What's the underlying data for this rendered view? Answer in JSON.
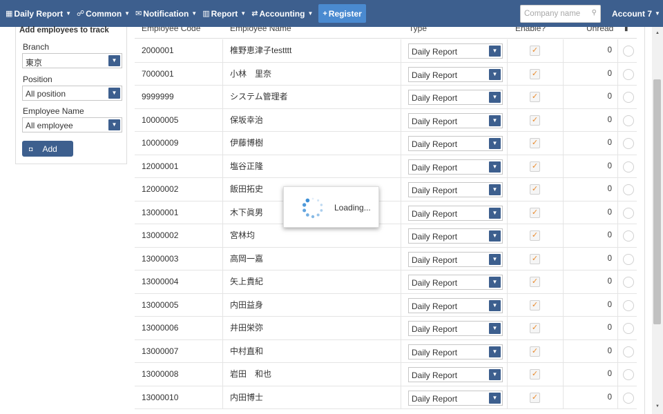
{
  "navbar": {
    "items": [
      {
        "label": "Daily Report",
        "icon": "calendar-icon",
        "glyph": "▦"
      },
      {
        "label": "Common",
        "icon": "users-icon",
        "glyph": "☍"
      },
      {
        "label": "Notification",
        "icon": "envelope-icon",
        "glyph": "✉"
      },
      {
        "label": "Report",
        "icon": "bar-chart-icon",
        "glyph": "▥"
      },
      {
        "label": "Accounting",
        "icon": "exchange-icon",
        "glyph": "⇄"
      }
    ],
    "register": {
      "label": "Register",
      "glyph": "+"
    },
    "search": {
      "placeholder": "Company name"
    },
    "account": {
      "label": "Account 7"
    },
    "caret": "▼",
    "search_glyph": "⚲",
    "color": "#3d5f8e",
    "register_color": "#4a8ad0"
  },
  "sidebar": {
    "title": "Add employees to track",
    "branch": {
      "label": "Branch",
      "value": "東京"
    },
    "position": {
      "label": "Position",
      "value": "All position"
    },
    "employee_name": {
      "label": "Employee Name",
      "value": "All employee"
    },
    "add_button": {
      "label": "Add",
      "glyph": "◘"
    }
  },
  "table": {
    "headers": {
      "code": "Employee Code",
      "name": "Employee Name",
      "type": "Type",
      "enable": "Enable?",
      "unread": "Unread",
      "delete_glyph": "▮"
    },
    "rows": [
      {
        "code": "2000001",
        "name": "椎野恵津子testttt",
        "type": "Daily Report",
        "enabled": "✓",
        "unread": "0"
      },
      {
        "code": "7000001",
        "name": "小林　里奈",
        "type": "Daily Report",
        "enabled": "✓",
        "unread": "0"
      },
      {
        "code": "9999999",
        "name": "システム管理者",
        "type": "Daily Report",
        "enabled": "✓",
        "unread": "0"
      },
      {
        "code": "10000005",
        "name": "保坂幸治",
        "type": "Daily Report",
        "enabled": "✓",
        "unread": "0"
      },
      {
        "code": "10000009",
        "name": "伊藤博樹",
        "type": "Daily Report",
        "enabled": "✓",
        "unread": "0"
      },
      {
        "code": "12000001",
        "name": "塩谷正隆",
        "type": "Daily Report",
        "enabled": "✓",
        "unread": "0"
      },
      {
        "code": "12000002",
        "name": "飯田拓史",
        "type": "Daily Report",
        "enabled": "✓",
        "unread": "0"
      },
      {
        "code": "13000001",
        "name": "木下眞男",
        "type": "Daily Report",
        "enabled": "✓",
        "unread": "0"
      },
      {
        "code": "13000002",
        "name": "宮林均",
        "type": "Daily Report",
        "enabled": "✓",
        "unread": "0"
      },
      {
        "code": "13000003",
        "name": "高岡一嘉",
        "type": "Daily Report",
        "enabled": "✓",
        "unread": "0"
      },
      {
        "code": "13000004",
        "name": "矢上貴紀",
        "type": "Daily Report",
        "enabled": "✓",
        "unread": "0"
      },
      {
        "code": "13000005",
        "name": "内田益身",
        "type": "Daily Report",
        "enabled": "✓",
        "unread": "0"
      },
      {
        "code": "13000006",
        "name": "井田栄弥",
        "type": "Daily Report",
        "enabled": "✓",
        "unread": "0"
      },
      {
        "code": "13000007",
        "name": "中村直和",
        "type": "Daily Report",
        "enabled": "✓",
        "unread": "0"
      },
      {
        "code": "13000008",
        "name": "岩田　和也",
        "type": "Daily Report",
        "enabled": "✓",
        "unread": "0"
      },
      {
        "code": "13000010",
        "name": "内田博士",
        "type": "Daily Report",
        "enabled": "✓",
        "unread": "0"
      }
    ],
    "checkbox_color": "#e9892a"
  },
  "loading": {
    "text": "Loading...",
    "spinner_color": "#3d8fd6"
  },
  "scrollbar": {
    "up": "▲",
    "down": "▼"
  }
}
